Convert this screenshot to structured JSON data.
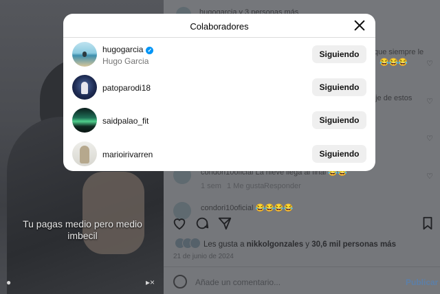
{
  "video": {
    "caption": "Tu pagas medio pero medio imbecil"
  },
  "post": {
    "header_text": "hugogarcia y 3 personas más",
    "comments": [
      {
        "text": "que siempre le",
        "suffix": "😂😂😂"
      },
      {
        "text": "aje de estos"
      },
      {
        "text": "condori10oficial La nieve llega al final 😂😂"
      },
      {
        "meta_time": "1 sem",
        "meta_likes": "1 Me gusta",
        "meta_reply": "Responder"
      },
      {
        "text": "condori10oficial 😂😂😂😂"
      }
    ],
    "likes": {
      "prefix": "Les gusta a ",
      "user": "nikkolgonzales",
      "middle": " y ",
      "count": "30,6 mil personas más"
    },
    "date": "21 de junio de 2024",
    "comment_placeholder": "Añade un comentario...",
    "publish_label": "Publicar"
  },
  "modal": {
    "title": "Colaboradores",
    "collaborators": [
      {
        "username": "hugogarcia",
        "full_name": "Hugo Garcia",
        "verified": true,
        "button": "Siguiendo"
      },
      {
        "username": "patoparodi18",
        "full_name": "",
        "verified": false,
        "button": "Siguiendo"
      },
      {
        "username": "saidpalao_fit",
        "full_name": "",
        "verified": false,
        "button": "Siguiendo"
      },
      {
        "username": "marioirivarren",
        "full_name": "",
        "verified": false,
        "button": "Siguiendo"
      }
    ]
  },
  "colors": {
    "verified_badge": "#0095f6",
    "button_bg": "#efefef",
    "overlay": "#6f7175"
  },
  "icons": [
    "close-icon",
    "verified-icon",
    "heart-icon",
    "comment-icon",
    "share-icon",
    "bookmark-icon",
    "emoji-icon",
    "user-icon",
    "mute-icon"
  ]
}
